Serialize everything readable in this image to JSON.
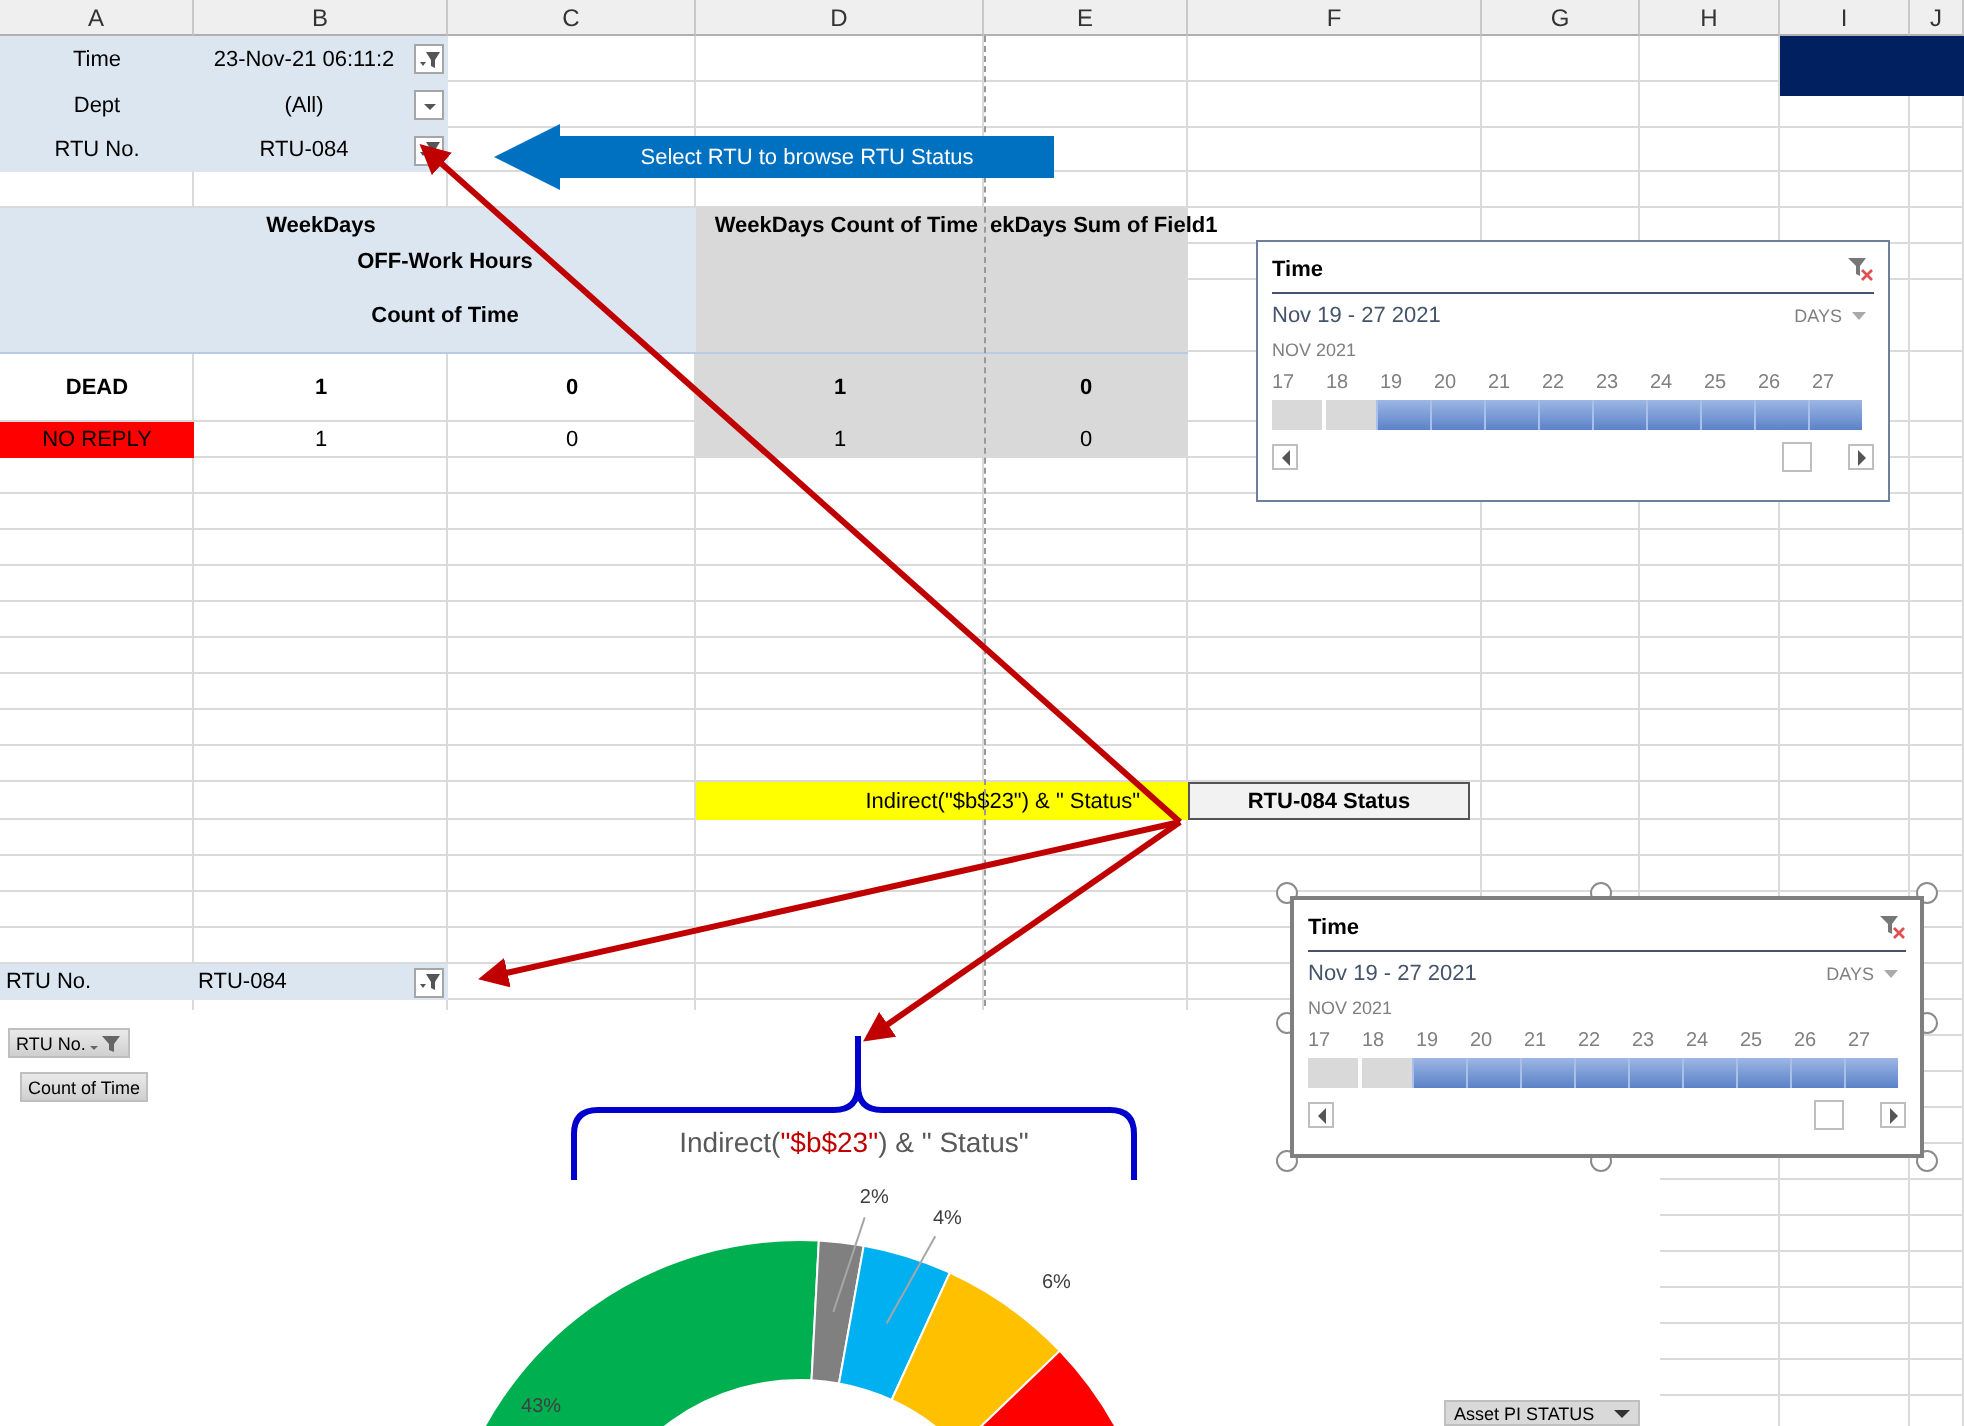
{
  "columns": [
    "A",
    "B",
    "C",
    "D",
    "E",
    "F",
    "G",
    "H",
    "I",
    "J"
  ],
  "report_filters": [
    {
      "label": "Time",
      "value": "23-Nov-21 06:11:2",
      "filtered": true
    },
    {
      "label": "Dept",
      "value": "(All)",
      "filtered": false
    },
    {
      "label": "RTU No.",
      "value": "RTU-084",
      "filtered": true
    }
  ],
  "callout": {
    "text": "Select RTU  to browse RTU Status"
  },
  "pivot": {
    "column_field": "WeekDays",
    "sub_field": "OFF-Work Hours",
    "value_field": "Count of Time",
    "total_1": "WeekDays Count of Time",
    "total_2": "ekDays Sum of Field1",
    "rows": [
      {
        "label": "DEAD",
        "bold": true,
        "highlight": false,
        "values": [
          "1",
          "0",
          "1",
          "0"
        ]
      },
      {
        "label": "NO REPLY",
        "bold": false,
        "highlight": true,
        "values": [
          "1",
          "0",
          "1",
          "0"
        ]
      }
    ]
  },
  "formula_cell": {
    "text": "Indirect(\"$b$23\") & \" Status\""
  },
  "result_cell": {
    "text": "RTU-084 Status"
  },
  "timelines": [
    {
      "title": "Time",
      "range": "Nov 19 - 27 2021",
      "level": "DAYS",
      "month": "NOV 2021",
      "selected": false,
      "days": [
        {
          "label": "17",
          "selected": false
        },
        {
          "label": "18",
          "selected": false
        },
        {
          "label": "19",
          "selected": true
        },
        {
          "label": "20",
          "selected": true
        },
        {
          "label": "21",
          "selected": true
        },
        {
          "label": "22",
          "selected": true
        },
        {
          "label": "23",
          "selected": true
        },
        {
          "label": "24",
          "selected": true
        },
        {
          "label": "25",
          "selected": true
        },
        {
          "label": "26",
          "selected": true
        },
        {
          "label": "27",
          "selected": true
        }
      ]
    },
    {
      "title": "Time",
      "range": "Nov 19 - 27 2021",
      "level": "DAYS",
      "month": "NOV 2021",
      "selected": true,
      "days": [
        {
          "label": "17",
          "selected": false
        },
        {
          "label": "18",
          "selected": false
        },
        {
          "label": "19",
          "selected": true
        },
        {
          "label": "20",
          "selected": true
        },
        {
          "label": "21",
          "selected": true
        },
        {
          "label": "22",
          "selected": true
        },
        {
          "label": "23",
          "selected": true
        },
        {
          "label": "24",
          "selected": true
        },
        {
          "label": "25",
          "selected": true
        },
        {
          "label": "26",
          "selected": true
        },
        {
          "label": "27",
          "selected": true
        }
      ]
    }
  ],
  "lower_filter": {
    "label": "RTU No.",
    "value": "RTU-084",
    "filtered": true
  },
  "chart": {
    "field_buttons": [
      {
        "label": "RTU No.",
        "kind": "filter"
      },
      {
        "label": "Count of Time",
        "kind": "value"
      }
    ],
    "brace_label": [
      {
        "text": "Indirect(",
        "highlight": false
      },
      {
        "text": "\"$b$23\"",
        "highlight": true
      },
      {
        "text": ") & \"  Status\"",
        "highlight": false
      }
    ],
    "chart_data": {
      "type": "donut",
      "values": [
        43,
        2,
        4,
        6,
        45
      ],
      "colors": [
        "#00b050",
        "#808080",
        "#00b0f0",
        "#ffc000",
        "#ff0000"
      ],
      "data_labels": true,
      "value_labels": [
        "43%",
        "2%",
        "4%",
        "6%",
        null
      ]
    },
    "axis_button": {
      "label": "Asset PI STATUS"
    }
  }
}
